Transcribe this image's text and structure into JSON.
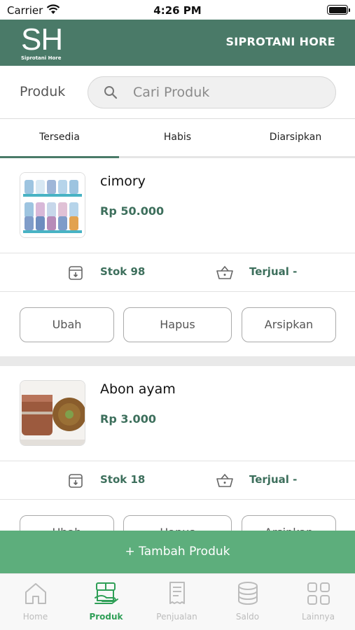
{
  "status_bar": {
    "carrier": "Carrier",
    "time": "4:26 PM"
  },
  "header": {
    "logo_mark": "SH",
    "logo_subtitle": "Siprotani Hore",
    "title": "SIPROTANI HORE"
  },
  "search": {
    "label": "Produk",
    "placeholder": "Cari Produk",
    "value": ""
  },
  "tabs": [
    {
      "label": "Tersedia",
      "active": true
    },
    {
      "label": "Habis",
      "active": false
    },
    {
      "label": "Diarsipkan",
      "active": false
    }
  ],
  "products": [
    {
      "name": "cimory",
      "price": "Rp 50.000",
      "stock": "Stok 98",
      "sold": "Terjual -"
    },
    {
      "name": "Abon ayam",
      "price": "Rp 3.000",
      "stock": "Stok 18",
      "sold": "Terjual -"
    }
  ],
  "actions": {
    "edit": "Ubah",
    "delete": "Hapus",
    "archive": "Arsipkan"
  },
  "add_button": {
    "label": "+ Tambah Produk"
  },
  "bottom_nav": [
    {
      "label": "Home",
      "icon": "home-icon",
      "active": false
    },
    {
      "label": "Produk",
      "icon": "product-box-icon",
      "active": true
    },
    {
      "label": "Penjualan",
      "icon": "receipt-icon",
      "active": false
    },
    {
      "label": "Saldo",
      "icon": "coins-stack-icon",
      "active": false
    },
    {
      "label": "Lainnya",
      "icon": "grid-icon",
      "active": false
    }
  ],
  "colors": {
    "brand": "#4a7a68",
    "accent": "#3d6f5c",
    "add_bar": "#5dae7c",
    "nav_active": "#2f9f57",
    "nav_inactive": "#bcbcbc"
  }
}
